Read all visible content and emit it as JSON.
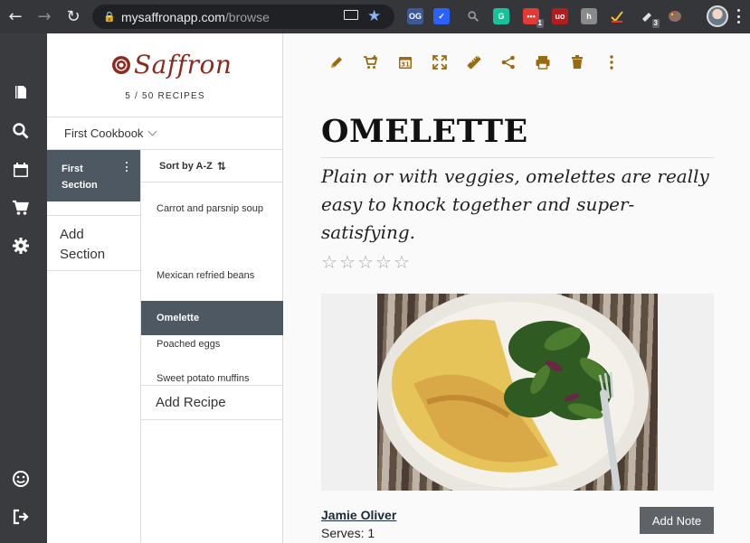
{
  "browser": {
    "url_domain": "mysaffronapp.com",
    "url_path": "/browse",
    "extensions": [
      {
        "name": "og-extension",
        "label": "OG",
        "color": "#3c5a99"
      },
      {
        "name": "checklist-extension",
        "label": "✓",
        "color": "#2962ff"
      },
      {
        "name": "magnifier-extension",
        "label": "",
        "color": "#35363a"
      },
      {
        "name": "grammarly-extension",
        "label": "G",
        "color": "#15c39a"
      },
      {
        "name": "counter-extension",
        "label": "•••",
        "color": "#e53935",
        "badge": "1"
      },
      {
        "name": "ublock-extension",
        "label": "uo",
        "color": "#b71c1c"
      },
      {
        "name": "ghostery-extension",
        "label": "h",
        "color": "#8a8a8a"
      },
      {
        "name": "check-extension",
        "label": "✓",
        "color": "#35363a"
      },
      {
        "name": "link-extension",
        "label": "",
        "color": "#35363a",
        "badge": "3"
      },
      {
        "name": "palette-extension",
        "label": "",
        "color": "#35363a"
      }
    ]
  },
  "sidebar_icons": [
    "book-icon",
    "search-icon",
    "calendar-icon",
    "cart-icon",
    "gear-icon",
    "smiley-icon",
    "logout-icon"
  ],
  "brand": {
    "name": "Saffron",
    "recipe_count": "5 / 50 RECIPES"
  },
  "cookbook": {
    "selected": "First Cookbook"
  },
  "sections": {
    "items": [
      {
        "label": "First Section"
      }
    ],
    "add_label": "Add Section"
  },
  "recipes": {
    "sort_label": "Sort by A-Z",
    "items": [
      {
        "label": "Carrot and parsnip soup",
        "active": false
      },
      {
        "label": "Mexican refried beans",
        "active": false
      },
      {
        "label": "Omelette",
        "active": true
      },
      {
        "label": "Poached eggs",
        "active": false
      },
      {
        "label": "Sweet potato muffins",
        "active": false
      }
    ],
    "add_label": "Add Recipe"
  },
  "recipe": {
    "title": "OMELETTE",
    "description": "Plain or with veggies, omelettes are really easy to knock together and super-satisfying.",
    "rating": 0,
    "rating_max": 5,
    "author": "Jamie Oliver",
    "serves": "Serves: 1",
    "add_note_label": "Add Note"
  },
  "toolbar_icons": [
    "edit-icon",
    "add-to-cart-icon",
    "calendar-add-icon",
    "expand-icon",
    "ruler-icon",
    "share-icon",
    "print-icon",
    "delete-icon",
    "more-icon"
  ],
  "colors": {
    "accent": "#9a6a12",
    "brand": "#8b2a1e",
    "active_bg": "#4e5862",
    "rail_bg": "#3a3b3f"
  }
}
